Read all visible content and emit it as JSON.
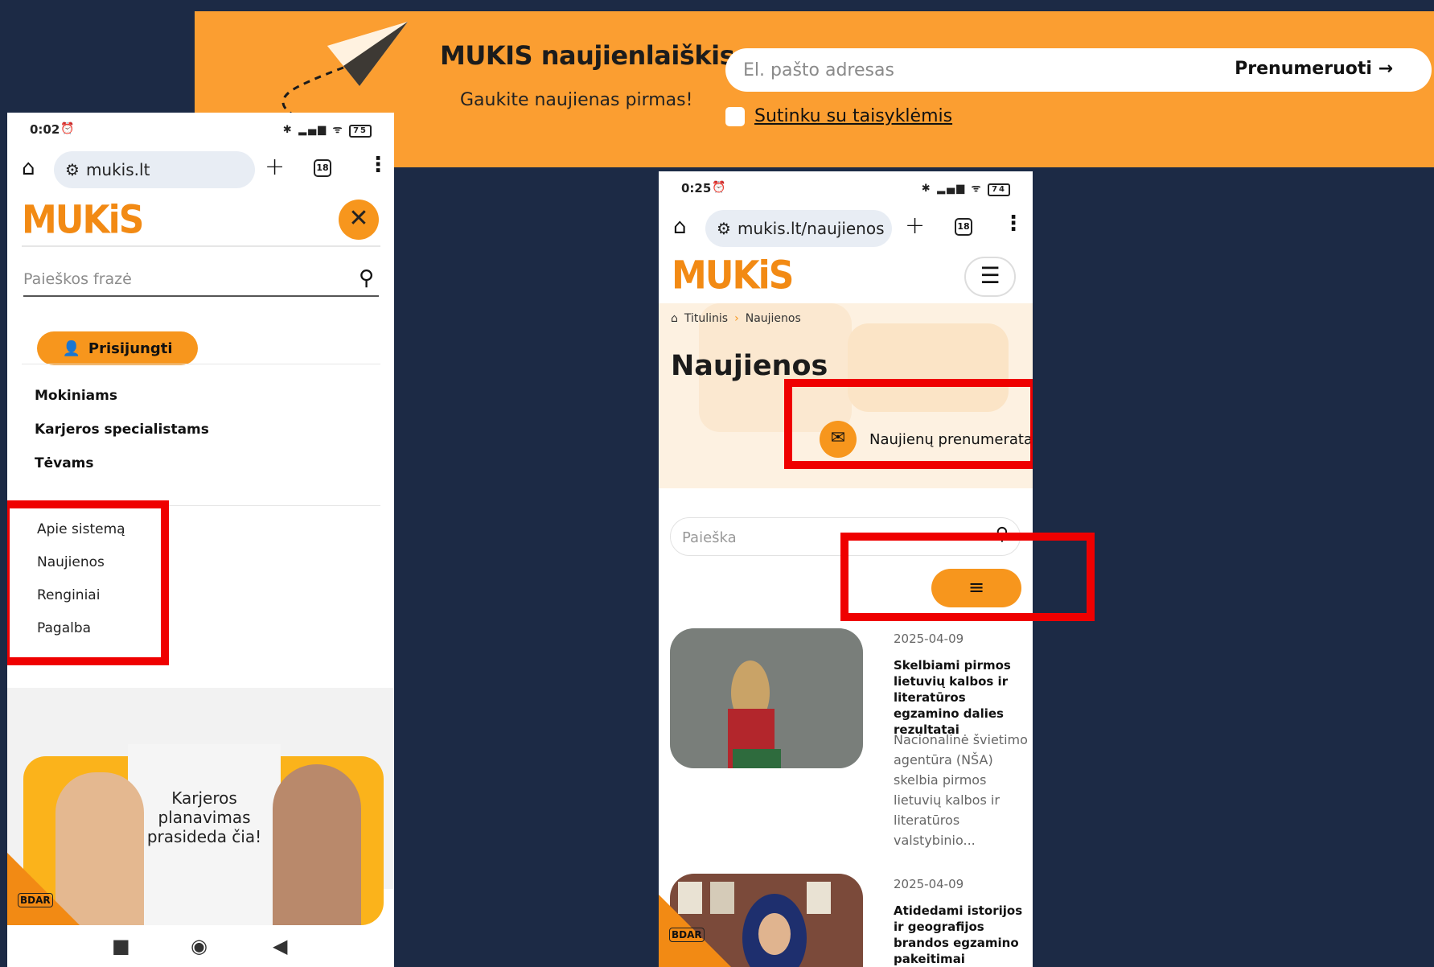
{
  "banner": {
    "title": "MUKIS naujienlaiškis",
    "subtitle": "Gaukite naujienas pirmas!",
    "email_placeholder": "El. pašto adresas",
    "subscribe_label": "Prenumeruoti →",
    "consent_label": "Sutinku su taisyklėmis"
  },
  "phone_left": {
    "status": {
      "time": "0:02",
      "battery": "75"
    },
    "url": "mukis.lt",
    "tab_count": "18",
    "logo": "MUKiS",
    "search_placeholder": "Paieškos frazė",
    "login_label": "Prisijungti",
    "main_nav": [
      "Mokiniams",
      "Karjeros specialistams",
      "Tėvams"
    ],
    "secondary_nav": [
      "Apie sistemą",
      "Naujienos",
      "Renginiai",
      "Pagalba"
    ],
    "promo_text": "Karjeros planavimas prasideda čia!",
    "bdar": "BDAR"
  },
  "phone_right": {
    "status": {
      "time": "0:25",
      "battery": "74"
    },
    "url": "mukis.lt/naujienos",
    "tab_count": "18",
    "logo": "MUKiS",
    "breadcrumb": {
      "home": "Titulinis",
      "current": "Naujienos"
    },
    "page_title": "Naujienos",
    "subscribe_label": "Naujienų prenumerata",
    "search_placeholder": "Paieška",
    "bdar": "BDAR",
    "articles": [
      {
        "date": "2025-04-09",
        "title": "Skelbiami pirmos lietuvių kalbos ir literatūros egzamino dalies rezultatai",
        "excerpt": "Nacionalinė švietimo agentūra (NŠA) skelbia pirmos lietuvių kalbos ir literatūros valstybinio..."
      },
      {
        "date": "2025-04-09",
        "title": "Atidedami istorijos ir geografijos brandos egzamino pakeitimai",
        "excerpt": ""
      }
    ]
  },
  "colors": {
    "background": "#1c2a45",
    "accent": "#f7961d",
    "highlight": "#ef0000"
  }
}
